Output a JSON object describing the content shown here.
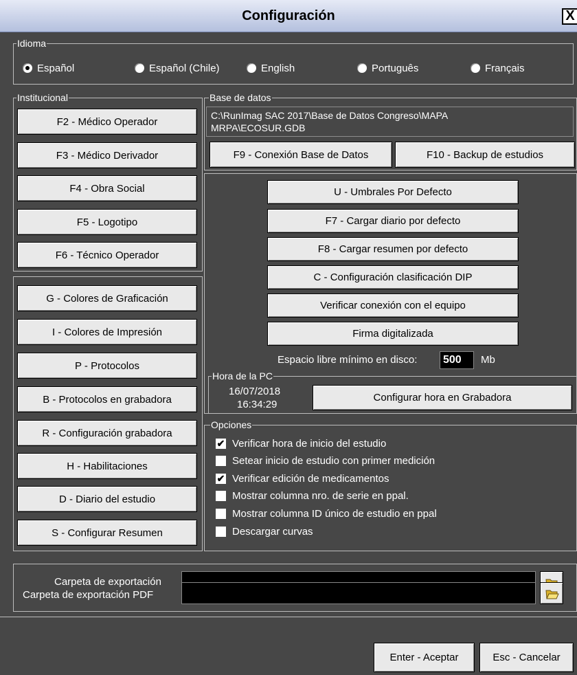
{
  "window": {
    "title": "Configuración",
    "close_label": "X"
  },
  "idioma": {
    "legend": "Idioma",
    "options": [
      {
        "label": "Español",
        "selected": true
      },
      {
        "label": "Español (Chile)",
        "selected": false
      },
      {
        "label": "English",
        "selected": false
      },
      {
        "label": "Português",
        "selected": false
      },
      {
        "label": "Français",
        "selected": false
      }
    ]
  },
  "institucional": {
    "legend": "Institucional",
    "buttons": [
      "F2 - Médico Operador",
      "F3 - Médico Derivador",
      "F4 - Obra Social",
      "F5 - Logotipo",
      "F6 - Técnico Operador"
    ]
  },
  "left_buttons": [
    "G - Colores de Graficación",
    "I - Colores de Impresión",
    "P - Protocolos",
    "B - Protocolos en grabadora",
    "R - Configuración grabadora",
    "H - Habilitaciones",
    "D - Diario del estudio",
    "S - Configurar Resumen"
  ],
  "base_datos": {
    "legend": "Base de datos",
    "path_line1": "C:\\RunImag SAC 2017\\Base de Datos Congreso\\MAPA",
    "path_line2": "MRPA\\ECOSUR.GDB",
    "connect_button": "F9 - Conexión Base de Datos",
    "backup_button": "F10 - Backup de estudios"
  },
  "center_buttons": [
    "U - Umbrales Por Defecto",
    "F7 - Cargar diario por defecto",
    "F8 - Cargar resumen por defecto",
    "C - Configuración clasificación DIP",
    "Verificar conexión con el equipo",
    "Firma digitalizada"
  ],
  "disk": {
    "label": "Espacio libre mínimo en disco:",
    "value": "500",
    "unit": "Mb"
  },
  "hora_pc": {
    "legend": "Hora de la PC",
    "date": "16/07/2018",
    "time": "16:34:29",
    "button": "Configurar hora en Grabadora"
  },
  "opciones": {
    "legend": "Opciones",
    "items": [
      {
        "label": "Verificar hora de inicio del estudio",
        "checked": true
      },
      {
        "label": "Setear inicio de estudio con primer medición",
        "checked": false
      },
      {
        "label": "Verificar edición de medicamentos",
        "checked": true
      },
      {
        "label": "Mostrar columna nro. de serie en ppal.",
        "checked": false
      },
      {
        "label": "Mostrar columna ID único de estudio en ppal",
        "checked": false
      },
      {
        "label": "Descargar curvas",
        "checked": false
      }
    ]
  },
  "export": {
    "folder_label": "Carpeta de exportación",
    "folder_value": "",
    "pdf_label": "Carpeta de exportación PDF",
    "pdf_value": ""
  },
  "footer": {
    "accept": "Enter - Aceptar",
    "cancel": "Esc - Cancelar"
  },
  "icons": {
    "folder": "folder-open-icon",
    "close": "close-icon"
  }
}
